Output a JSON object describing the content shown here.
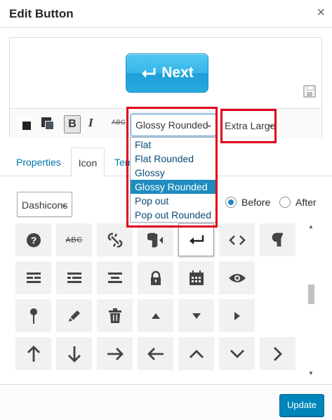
{
  "header": {
    "title": "Edit Button",
    "close_glyph": "×"
  },
  "preview": {
    "button_label": "Next",
    "button_icon": "return-arrow-icon",
    "button_color": "#35b5e8"
  },
  "toolbar": {
    "bold": "B",
    "italic": "I",
    "strike": "ABC",
    "style_select": {
      "value": "Glossy Rounded"
    },
    "size_select": {
      "value": "Extra Large"
    }
  },
  "style_options": [
    "Flat",
    "Flat Rounded",
    "Glossy",
    "Glossy Rounded",
    "Pop out",
    "Pop out Rounded"
  ],
  "tabs": {
    "properties": "Properties",
    "icon": "Icon",
    "third": "Tem"
  },
  "icon_panel": {
    "icon_set": "Dashicons",
    "position_before": "Before",
    "position_after": "After",
    "position_selected": "Before"
  },
  "icons": [
    [
      "help",
      "strikethrough",
      "editor-unlink",
      "editor-rtl",
      "editor-break",
      "editor-code",
      "editor-paragraph"
    ],
    [
      "align-left",
      "align-right",
      "align-center",
      "lock",
      "calendar",
      "visibility"
    ],
    [
      "location",
      "edit",
      "trash",
      "arrow-up",
      "arrow-down",
      "arrow-right"
    ],
    [
      "arrow-up-alt",
      "arrow-down-alt",
      "arrow-right-alt",
      "arrow-left-alt",
      "arrow-up-alt2",
      "arrow-down-alt2",
      "arrow-right-alt2"
    ]
  ],
  "footer": {
    "update": "Update"
  },
  "colors": {
    "accent": "#0085ba",
    "highlight_box": "#e0001b",
    "selection": "#1e8cbe"
  }
}
